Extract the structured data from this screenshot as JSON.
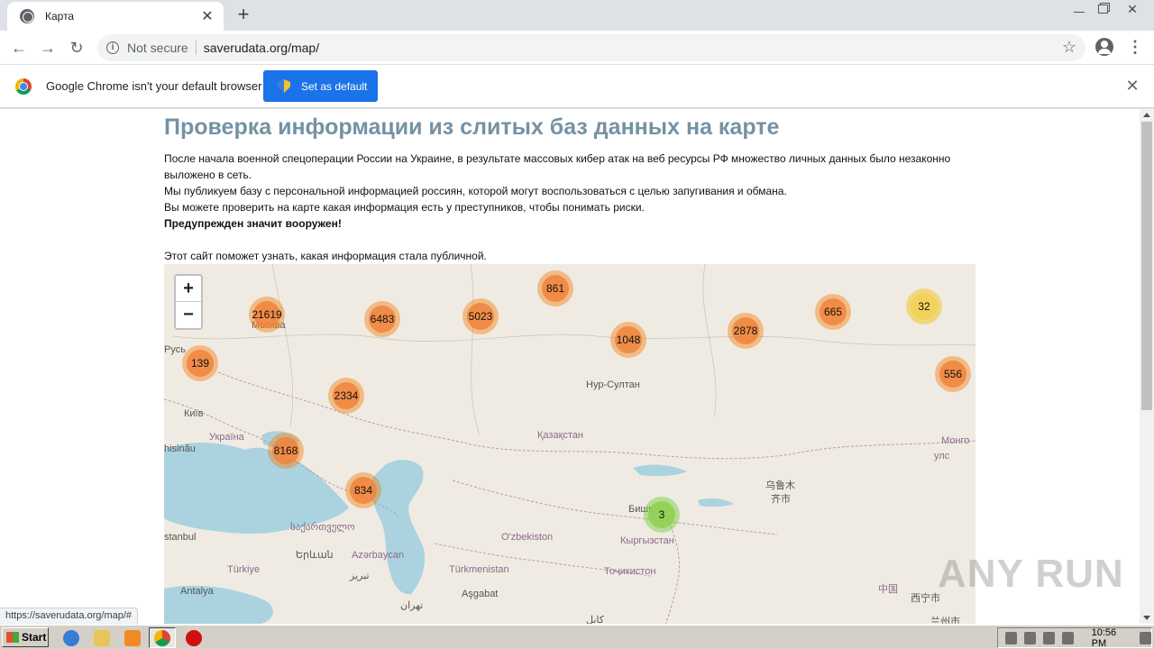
{
  "browser": {
    "tab_title": "Карта",
    "new_tab_symbol": "+",
    "tab_close_symbol": "✕",
    "security_label": "Not secure",
    "url": "saverudata.org/map/",
    "infobar_text": "Google Chrome isn't your default browser",
    "set_default_label": "Set as default",
    "status_url": "https://saverudata.org/map/#"
  },
  "page": {
    "title": "Проверка информации из слитых баз данных на карте",
    "paragraph_line1": "После начала военной спецоперации России на Украине, в результате массовых кибер атак на веб ресурсы РФ множество личных данных было незаконно",
    "paragraph_line2": "выложено в сеть.",
    "paragraph_line3": "Мы публикуем базу с персональной информацией россиян, которой могут воспользоваться с целью запугивания и обмана.",
    "paragraph_line4": "Вы можете проверить на карте какая информация есть у преступников, чтобы понимать риски.",
    "warning": "Предупрежден значит вооружен!",
    "intro": "Этот сайт поможет узнать, какая информация стала публичной."
  },
  "map": {
    "zoom_in": "+",
    "zoom_out": "−",
    "clusters": [
      {
        "count": "21619",
        "color": "orange"
      },
      {
        "count": "6483",
        "color": "orange"
      },
      {
        "count": "5023",
        "color": "orange"
      },
      {
        "count": "861",
        "color": "orange"
      },
      {
        "count": "1048",
        "color": "orange"
      },
      {
        "count": "2878",
        "color": "orange"
      },
      {
        "count": "665",
        "color": "orange"
      },
      {
        "count": "32",
        "color": "yellow"
      },
      {
        "count": "556",
        "color": "orange"
      },
      {
        "count": "139",
        "color": "orange"
      },
      {
        "count": "2334",
        "color": "orange"
      },
      {
        "count": "8168",
        "color": "orange"
      },
      {
        "count": "834",
        "color": "orange"
      },
      {
        "count": "3",
        "color": "green"
      }
    ],
    "labels": {
      "moskva": "Москва",
      "rus": "Русь",
      "kyiv": "Київ",
      "ukraina": "Україна",
      "chisinau": "hisinău",
      "nursultan": "Нур-Султан",
      "kazakhstan": "Қазақстан",
      "mongol": "Монго",
      "mongol2": "улс",
      "urumqi1": "乌鲁木",
      "urumqi2": "齐市",
      "bishkek": "Бишк",
      "kyrgyzstan": "Кыргызстан",
      "georgia": "საქართველო",
      "istanbul": "stanbul",
      "yerevan": "Երևան",
      "azerbaycan": "Azərbaycan",
      "ozbekiston": "O'zbekiston",
      "turkmenistan": "Türkmenistan",
      "tojikiston": "Тоҷикистон",
      "turkiye": "Türkiye",
      "tabriz": "تبریز",
      "antalya": "Antalya",
      "ashgabat": "Aşgabat",
      "tehran": "تهران",
      "kabul": "کابل",
      "china": "中国",
      "xining": "西宁市",
      "lanzhou": "兰州市"
    }
  },
  "watermark": "ANY RUN",
  "taskbar": {
    "start_label": "Start",
    "clock": "10:56 PM"
  },
  "colors": {
    "title": "#7592a4",
    "cluster_orange": "#f0843c",
    "cluster_yellow": "#f1d357",
    "cluster_green": "#90d250",
    "accent_button": "#1a73e8",
    "water": "#aad3df"
  }
}
